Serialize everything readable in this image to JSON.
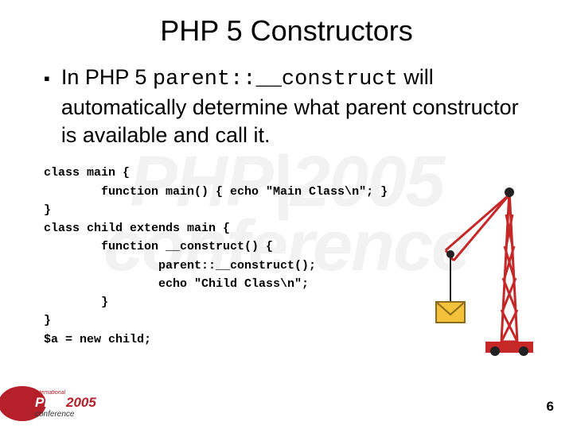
{
  "title": "PHP 5 Constructors",
  "bullet": {
    "prefix": "In PHP 5 ",
    "code": "parent::__construct",
    "suffix": " will automatically determine what parent constructor is available and call it."
  },
  "code_lines": [
    "class main {",
    "        function main() { echo \"Main Class\\n\"; }",
    "}",
    "class child extends main {",
    "        function __construct() {",
    "                parent::__construct();",
    "                echo \"Child Class\\n\";",
    "        }",
    "}",
    "$a = new child;"
  ],
  "watermark": {
    "line1": "PHP|2005",
    "line2": "conference"
  },
  "logo": {
    "line1": "international",
    "line2": "PHP",
    "line3": "2005",
    "line4": "conference"
  },
  "page_number": "6"
}
